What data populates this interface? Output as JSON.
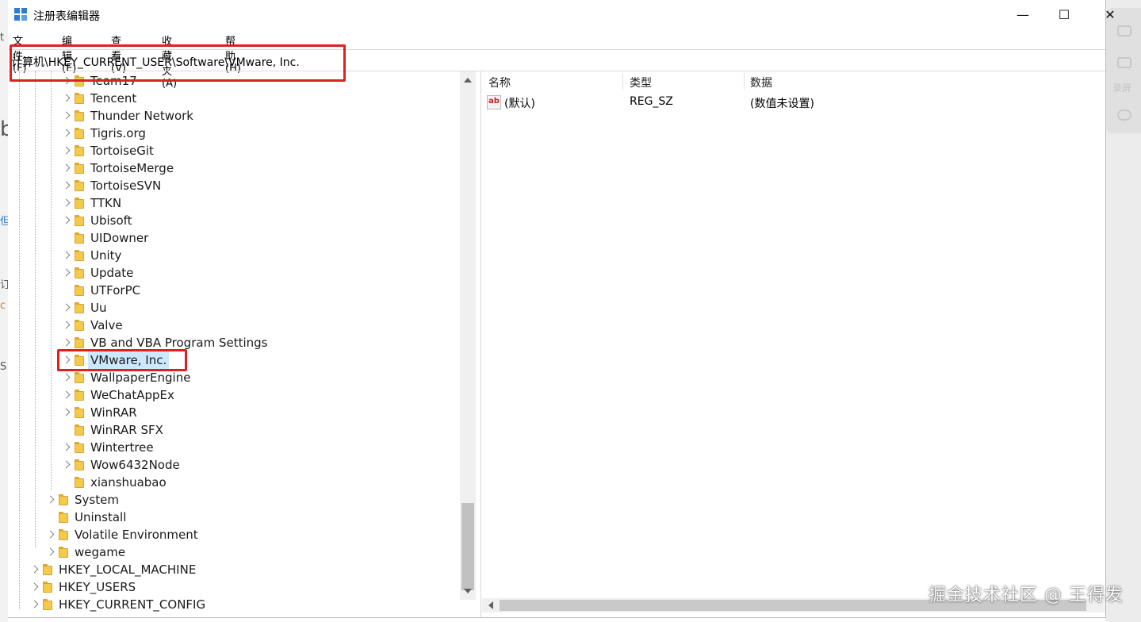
{
  "window": {
    "title": "注册表编辑器",
    "controls": {
      "minimize": "—",
      "maximize": "☐",
      "close": "✕"
    }
  },
  "menu": [
    "文件(F)",
    "编辑(E)",
    "查看(V)",
    "收藏夹(A)",
    "帮助(H)"
  ],
  "address": "计算机\\HKEY_CURRENT_USER\\Software\\VMware, Inc.",
  "tree": [
    {
      "label": "Team17",
      "expandable": true
    },
    {
      "label": "Tencent",
      "expandable": true
    },
    {
      "label": "Thunder Network",
      "expandable": true
    },
    {
      "label": "Tigris.org",
      "expandable": true
    },
    {
      "label": "TortoiseGit",
      "expandable": true
    },
    {
      "label": "TortoiseMerge",
      "expandable": true
    },
    {
      "label": "TortoiseSVN",
      "expandable": true
    },
    {
      "label": "TTKN",
      "expandable": true
    },
    {
      "label": "Ubisoft",
      "expandable": true
    },
    {
      "label": "UIDowner",
      "expandable": false
    },
    {
      "label": "Unity",
      "expandable": true
    },
    {
      "label": "Update",
      "expandable": true
    },
    {
      "label": "UTForPC",
      "expandable": false
    },
    {
      "label": "Uu",
      "expandable": true
    },
    {
      "label": "Valve",
      "expandable": true
    },
    {
      "label": "VB and VBA Program Settings",
      "expandable": true
    },
    {
      "label": "VMware, Inc.",
      "expandable": true,
      "selected": true
    },
    {
      "label": "WallpaperEngine",
      "expandable": true
    },
    {
      "label": "WeChatAppEx",
      "expandable": true
    },
    {
      "label": "WinRAR",
      "expandable": true
    },
    {
      "label": "WinRAR SFX",
      "expandable": false
    },
    {
      "label": "Wintertree",
      "expandable": true
    },
    {
      "label": "Wow6432Node",
      "expandable": true
    },
    {
      "label": "xianshuabao",
      "expandable": false
    },
    {
      "label": "System",
      "expandable": true
    },
    {
      "label": "Uninstall",
      "expandable": false
    },
    {
      "label": "Volatile Environment",
      "expandable": true
    },
    {
      "label": "wegame",
      "expandable": true
    },
    {
      "label": "HKEY_LOCAL_MACHINE",
      "expandable": true
    },
    {
      "label": "HKEY_USERS",
      "expandable": true
    },
    {
      "label": "HKEY_CURRENT_CONFIG",
      "expandable": true
    }
  ],
  "values": {
    "columns": [
      "名称",
      "类型",
      "数据"
    ],
    "rows": [
      {
        "icon": "string-value-icon",
        "icon_text": "ab",
        "name": "(默认)",
        "type": "REG_SZ",
        "data": "(数值未设置)"
      }
    ]
  },
  "side_widget": {
    "label": "录屏"
  },
  "watermark": "掘金技术社区 @ 王得发",
  "colors": {
    "annotation": "#e02020",
    "selection": "#cce8ff",
    "folder": "#f5c94a",
    "app_icon": "#2b7cd3"
  }
}
